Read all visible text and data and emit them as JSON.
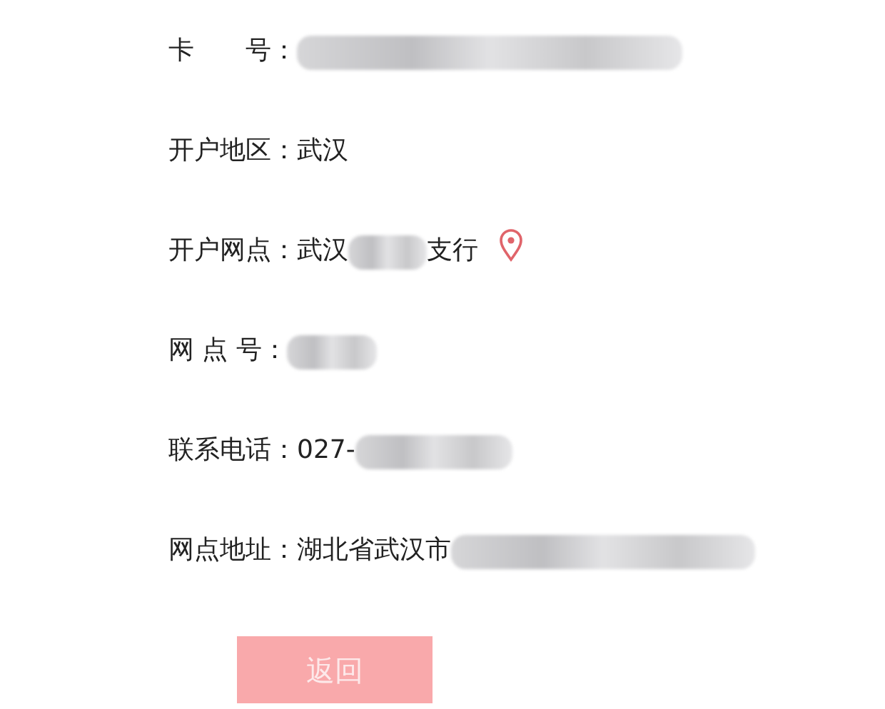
{
  "fields": [
    {
      "label": "卡　　号：",
      "masked": true
    },
    {
      "label": "开户地区：",
      "value": "武汉",
      "masked": false
    },
    {
      "label": "开户网点：",
      "value": "武汉",
      "masked": true,
      "value_after": "支行",
      "location_pin": true
    },
    {
      "label": "网 点 号：",
      "masked": true
    },
    {
      "label": "联系电话：",
      "value": "027-",
      "masked": true
    },
    {
      "label": "网点地址：",
      "value": "湖北省武汉市",
      "masked": true
    }
  ],
  "back_button": {
    "label": "返回",
    "disabled": true
  }
}
